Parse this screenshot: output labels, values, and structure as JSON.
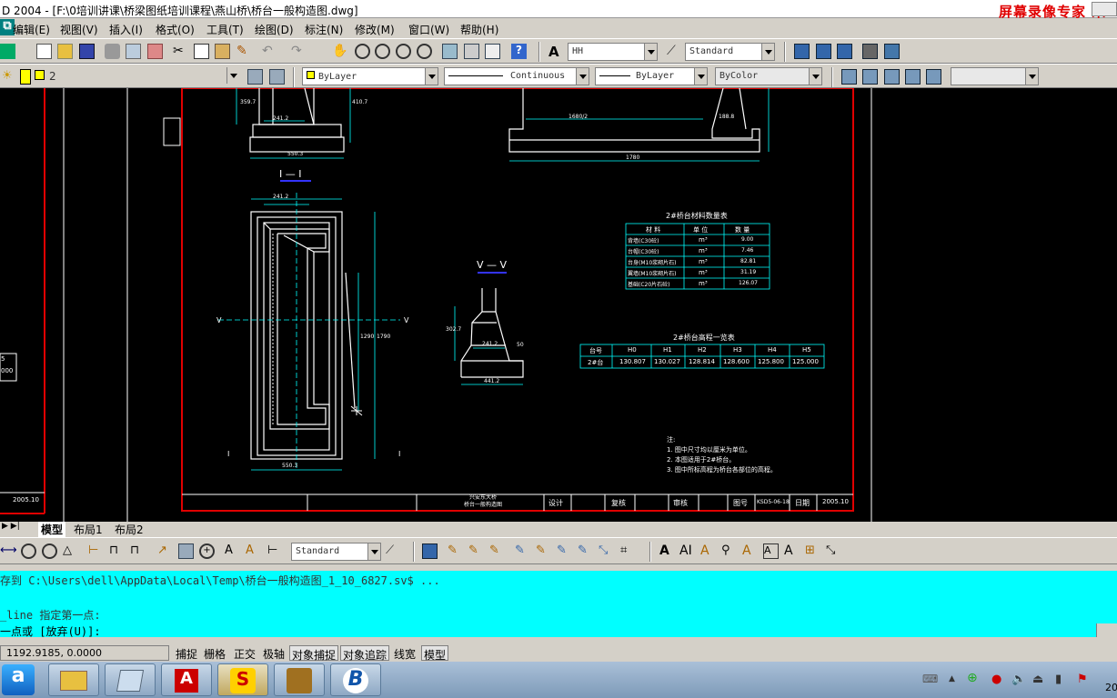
{
  "window": {
    "title": "D 2004 - [F:\\0培训讲课\\桥梁图纸培训课程\\燕山桥\\桥台一般构造图.dwg]",
    "watermark": "屏幕录像专家 未"
  },
  "menu": [
    "编辑(E)",
    "视图(V)",
    "插入(I)",
    "格式(O)",
    "工具(T)",
    "绘图(D)",
    "标注(N)",
    "修改(M)",
    "窗口(W)",
    "帮助(H)"
  ],
  "toolbar1": {
    "text_style": "HH",
    "dim_style": "Standard"
  },
  "toolbar2": {
    "layer": "2",
    "color": "ByLayer",
    "linetype": "Continuous",
    "lineweight": "ByLayer",
    "plotstyle": "ByColor"
  },
  "toolbar3": {
    "text_style": "Standard"
  },
  "tabs": [
    "模型",
    "布局1",
    "布局2"
  ],
  "drawing": {
    "section1": "I — I",
    "section5": "V — V",
    "dims": {
      "d1": "550.3",
      "d2": "241.2",
      "d3": "1680/2",
      "d4": "188.8",
      "d5": "1780",
      "d6": "241.2",
      "d7": "241.2",
      "d8": "441.2",
      "d9": "550.3",
      "d10": "1290",
      "d11": "1790",
      "d12": "359.7",
      "d13": "410.7",
      "d14": "50",
      "d15": "302.7"
    },
    "table1": {
      "title": "2#桥台材料数量表",
      "headers": [
        "材 料",
        "单 位",
        "数 量"
      ],
      "rows": [
        [
          "背墙(C30砼)",
          "m³",
          "9.00"
        ],
        [
          "台帽(C30砼)",
          "m³",
          "7.46"
        ],
        [
          "台身(M10浆砌片石)",
          "m³",
          "82.81"
        ],
        [
          "翼墙(M10浆砌片石)",
          "m³",
          "31.19"
        ],
        [
          "基础(C20片石砼)",
          "m³",
          "126.07"
        ]
      ]
    },
    "table2": {
      "title": "2#桥台高程一览表",
      "headers": [
        "台号",
        "H0",
        "H1",
        "H2",
        "H3",
        "H4",
        "H5"
      ],
      "rows": [
        [
          "2#台",
          "130.807",
          "130.027",
          "128.814",
          "128.600",
          "125.800",
          "125.000"
        ]
      ]
    },
    "notes": [
      "注:",
      "1. 图中尺寸均以厘米为单位。",
      "2. 本图适用于2#桥台。",
      "3. 图中所标高程为桥台各部位的高程。"
    ],
    "titleblock": {
      "proj": "兴安东大桥",
      "name": "桥台一般构造图",
      "design": "设计",
      "check": "复核",
      "review": "审核",
      "fig": "图号",
      "fignum": "KSD5-06-18",
      "date_label": "日期",
      "date": "2005.10"
    },
    "left_date": "2005.10",
    "left_val": "000"
  },
  "command": {
    "line1": "存到 C:\\Users\\dell\\AppData\\Local\\Temp\\桥台一般构造图_1_10_6827.sv$ ...",
    "line2": "_line 指定第一点:",
    "line3": "一点或 [放弃(U)]:"
  },
  "status": {
    "coords": "1192.9185, 0.0000",
    "buttons": [
      "捕捉",
      "栅格",
      "正交",
      "极轴",
      "对象捕捉",
      "对象追踪",
      "线宽",
      "模型"
    ]
  },
  "taskbar": {
    "clock": "20"
  }
}
